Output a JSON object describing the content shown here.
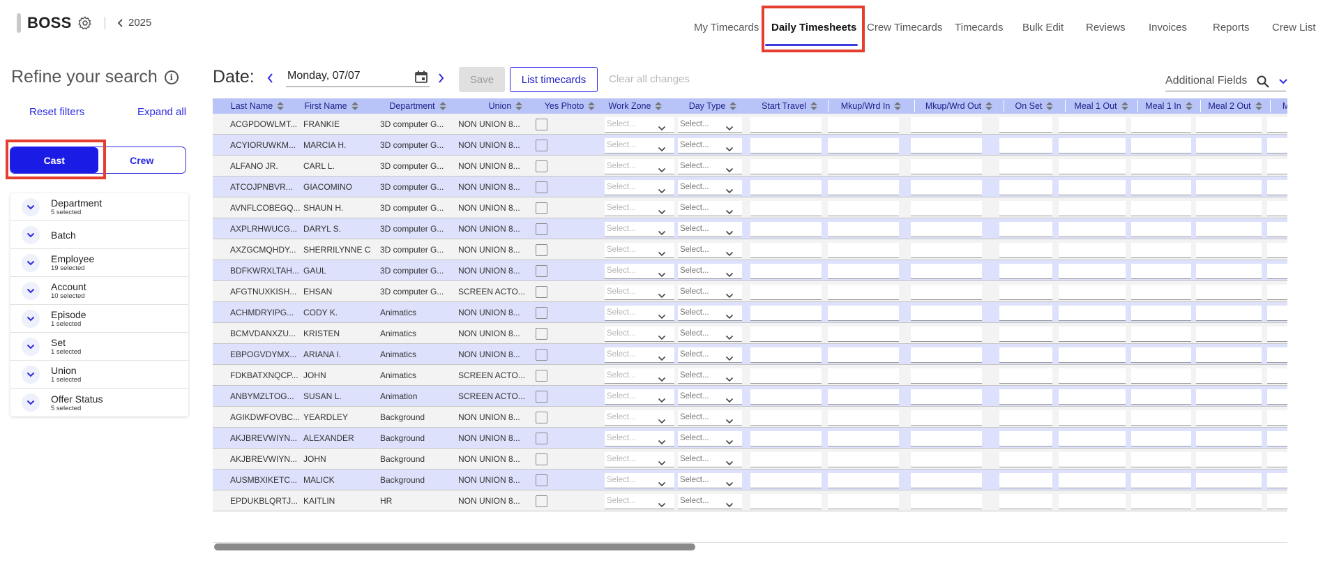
{
  "app": {
    "brand": "BOSS",
    "year": "2025",
    "nav": [
      "My Timecards",
      "Daily Timesheets",
      "Crew Timecards",
      "Timecards",
      "Bulk Edit",
      "Reviews",
      "Invoices",
      "Reports",
      "Crew List"
    ],
    "active_nav": "Daily Timesheets"
  },
  "sidebar": {
    "title": "Refine your search",
    "reset_label": "Reset filters",
    "expand_label": "Expand all",
    "toggle": {
      "cast": "Cast",
      "crew": "Crew",
      "selected": "Cast"
    },
    "filters": [
      {
        "label": "Department",
        "sub": "5 selected"
      },
      {
        "label": "Batch",
        "sub": ""
      },
      {
        "label": "Employee",
        "sub": "19 selected"
      },
      {
        "label": "Account",
        "sub": "10 selected"
      },
      {
        "label": "Episode",
        "sub": "1 selected"
      },
      {
        "label": "Set",
        "sub": "1 selected"
      },
      {
        "label": "Union",
        "sub": "1 selected"
      },
      {
        "label": "Offer Status",
        "sub": "5 selected"
      }
    ]
  },
  "toolbar": {
    "date_label": "Date:",
    "date_value": "Monday, 07/07",
    "save_label": "Save",
    "list_label": "List timecards",
    "clear_label": "Clear all changes",
    "additional_label": "Additional Fields"
  },
  "table": {
    "columns": [
      "Last Name",
      "First Name",
      "Department",
      "Union",
      "Yes Photo",
      "Work Zone",
      "Day Type",
      "Start Travel",
      "Mkup/Wrd In",
      "Mkup/Wrd Out",
      "On Set",
      "Meal 1 Out",
      "Meal 1 In",
      "Meal 2 Out",
      "Mea"
    ],
    "select_placeholder": "Select...",
    "rows": [
      {
        "last": "ACGPDOWLMT...",
        "first": "FRANKIE",
        "dept": "3D computer G...",
        "union": "NON UNION 8..."
      },
      {
        "last": "ACYIORUWKM...",
        "first": "MARCIA H.",
        "dept": "3D computer G...",
        "union": "NON UNION 8..."
      },
      {
        "last": "ALFANO JR.",
        "first": "CARL L.",
        "dept": "3D computer G...",
        "union": "NON UNION 8..."
      },
      {
        "last": "ATCOJPNBVR...",
        "first": "GIACOMINO",
        "dept": "3D computer G...",
        "union": "NON UNION 8..."
      },
      {
        "last": "AVNFLCOBEGQ...",
        "first": "SHAUN H.",
        "dept": "3D computer G...",
        "union": "NON UNION 8..."
      },
      {
        "last": "AXPLRHWUCG...",
        "first": "DARYL S.",
        "dept": "3D computer G...",
        "union": "NON UNION 8..."
      },
      {
        "last": "AXZGCMQHDY...",
        "first": "SHERRILYNNE C",
        "dept": "3D computer G...",
        "union": "NON UNION 8..."
      },
      {
        "last": "BDFKWRXLTAH...",
        "first": "GAUL",
        "dept": "3D computer G...",
        "union": "NON UNION 8..."
      },
      {
        "last": "AFGTNUXKISH...",
        "first": "EHSAN",
        "dept": "3D computer G...",
        "union": "SCREEN ACTO..."
      },
      {
        "last": "ACHMDRYIPG...",
        "first": "CODY K.",
        "dept": "Animatics",
        "union": "NON UNION 8..."
      },
      {
        "last": "BCMVDANXZU...",
        "first": "KRISTEN",
        "dept": "Animatics",
        "union": "NON UNION 8..."
      },
      {
        "last": "EBPOGVDYMX...",
        "first": "ARIANA I.",
        "dept": "Animatics",
        "union": "NON UNION 8..."
      },
      {
        "last": "FDKBATXNQCP...",
        "first": "JOHN",
        "dept": "Animatics",
        "union": "SCREEN ACTO..."
      },
      {
        "last": "ANBYMZLTOG...",
        "first": "SUSAN L.",
        "dept": "Animation",
        "union": "SCREEN ACTO..."
      },
      {
        "last": "AGIKDWFOVBC...",
        "first": "YEARDLEY",
        "dept": "Background",
        "union": "NON UNION 8..."
      },
      {
        "last": "AKJBREVWIYN...",
        "first": "ALEXANDER",
        "dept": "Background",
        "union": "NON UNION 8..."
      },
      {
        "last": "AKJBREVWIYN...",
        "first": "JOHN",
        "dept": "Background",
        "union": "NON UNION 8..."
      },
      {
        "last": "AUSMBXIKETC...",
        "first": "MALICK",
        "dept": "Background",
        "union": "NON UNION 8..."
      },
      {
        "last": "EPDUKBLQRTJ...",
        "first": "KAITLIN",
        "dept": "HR",
        "union": "NON UNION 8..."
      }
    ]
  },
  "colors": {
    "accent": "#2a2ae0",
    "header_bg": "#b8c4f7",
    "row_alt": "#dde1fb",
    "highlight": "#e53d2e"
  }
}
